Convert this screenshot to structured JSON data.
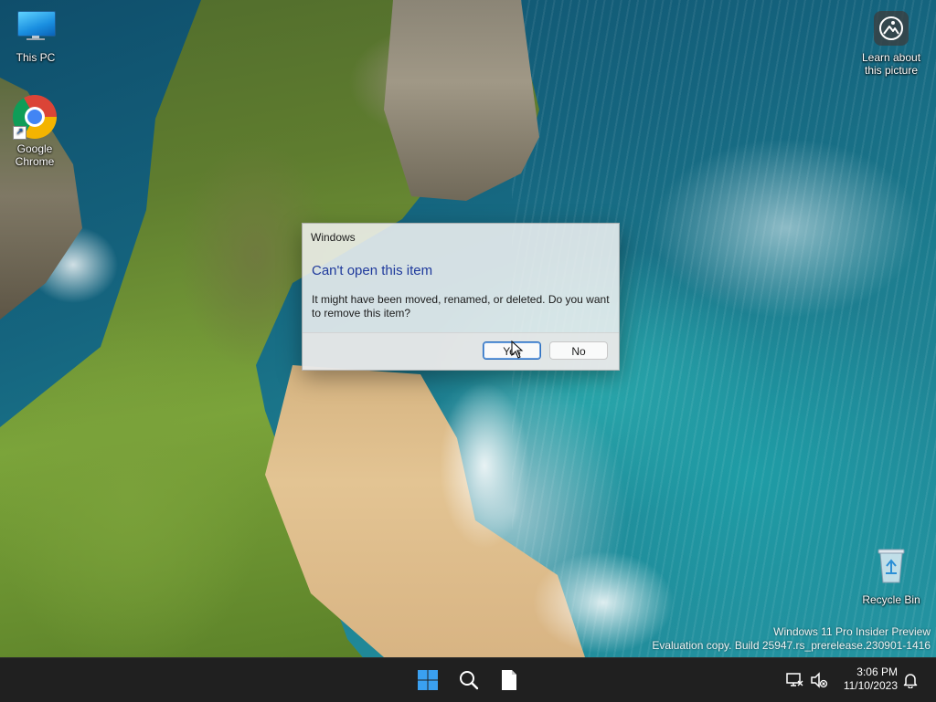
{
  "desktop": {
    "icons": [
      {
        "label": "This PC"
      },
      {
        "label": "Google\nChrome"
      },
      {
        "label": "Learn about\nthis picture"
      },
      {
        "label": "Recycle Bin"
      }
    ],
    "watermark": {
      "line1": "Windows 11 Pro Insider Preview",
      "line2": "Evaluation copy. Build 25947.rs_prerelease.230901-1416"
    }
  },
  "dialog": {
    "title": "Windows",
    "heading": "Can't open this item",
    "message": "It might have been moved, renamed, or deleted. Do you want to remove this item?",
    "yes_label": "Yes",
    "no_label": "No"
  },
  "taskbar": {
    "apps": [
      {
        "icon": "windows-start-icon"
      },
      {
        "icon": "search-icon"
      },
      {
        "icon": "file-icon"
      }
    ],
    "clock": {
      "time": "3:06 PM",
      "date": "11/10/2023"
    }
  },
  "colors": {
    "dialog_heading": "#1f3a9c",
    "taskbar_bg": "#202020",
    "start_blue": "#3aa0f0"
  }
}
